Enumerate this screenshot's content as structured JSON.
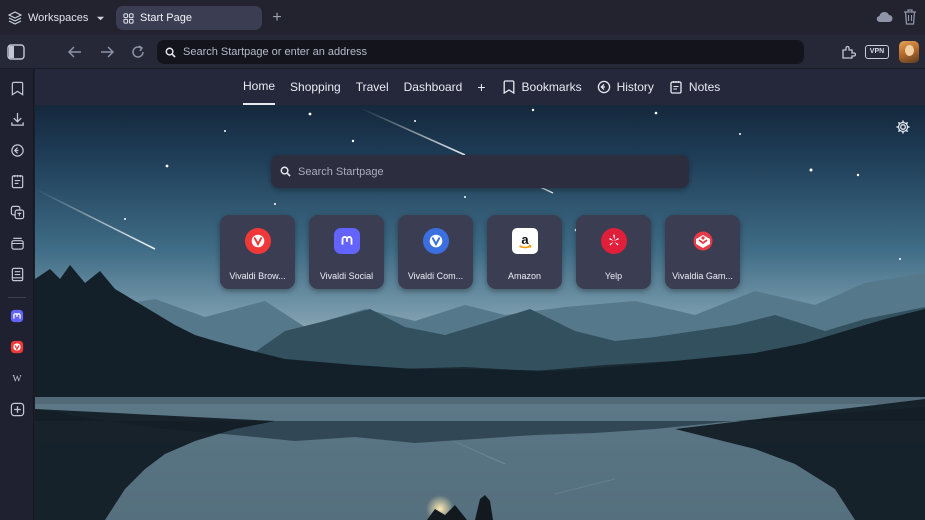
{
  "tabbar": {
    "workspaces_label": "Workspaces",
    "active_tab_label": "Start Page",
    "new_tab_glyph": "+"
  },
  "addressbar": {
    "placeholder": "Search Startpage or enter an address",
    "vpn_label": "VPN"
  },
  "startpage": {
    "nav": {
      "tabs": [
        {
          "label": "Home",
          "active": true
        },
        {
          "label": "Shopping"
        },
        {
          "label": "Travel"
        },
        {
          "label": "Dashboard"
        },
        {
          "label": "+"
        }
      ],
      "panels": [
        {
          "label": "Bookmarks",
          "icon": "bookmark-icon"
        },
        {
          "label": "History",
          "icon": "history-icon"
        },
        {
          "label": "Notes",
          "icon": "notes-icon"
        }
      ]
    },
    "search_placeholder": "Search Startpage",
    "speed_dials": [
      {
        "label": "Vivaldi Brow...",
        "icon": "vivaldi-icon",
        "color": "#ef3939"
      },
      {
        "label": "Vivaldi Social",
        "icon": "mastodon-icon",
        "color": "#6364ff"
      },
      {
        "label": "Vivaldi Com...",
        "icon": "vivaldi-community-icon",
        "color": "#3b6fe0"
      },
      {
        "label": "Amazon",
        "icon": "amazon-icon",
        "color": "#ffffff"
      },
      {
        "label": "Yelp",
        "icon": "yelp-icon",
        "color": "#e0203a"
      },
      {
        "label": "Vivaldia Gam...",
        "icon": "vivaldia-game-icon",
        "color": "#e63a46"
      }
    ]
  },
  "sidebar": {
    "items": [
      "bookmarks-panel-icon",
      "downloads-panel-icon",
      "history-panel-icon",
      "notes-panel-icon",
      "translate-panel-icon",
      "window-panel-icon",
      "reading-list-panel-icon",
      "mastodon-web-panel-icon",
      "vivaldi-web-panel-icon",
      "wikipedia-web-panel-icon",
      "add-web-panel-icon"
    ]
  },
  "theme": {
    "accent": "#3b3e52",
    "background": "#1d1f2b"
  }
}
